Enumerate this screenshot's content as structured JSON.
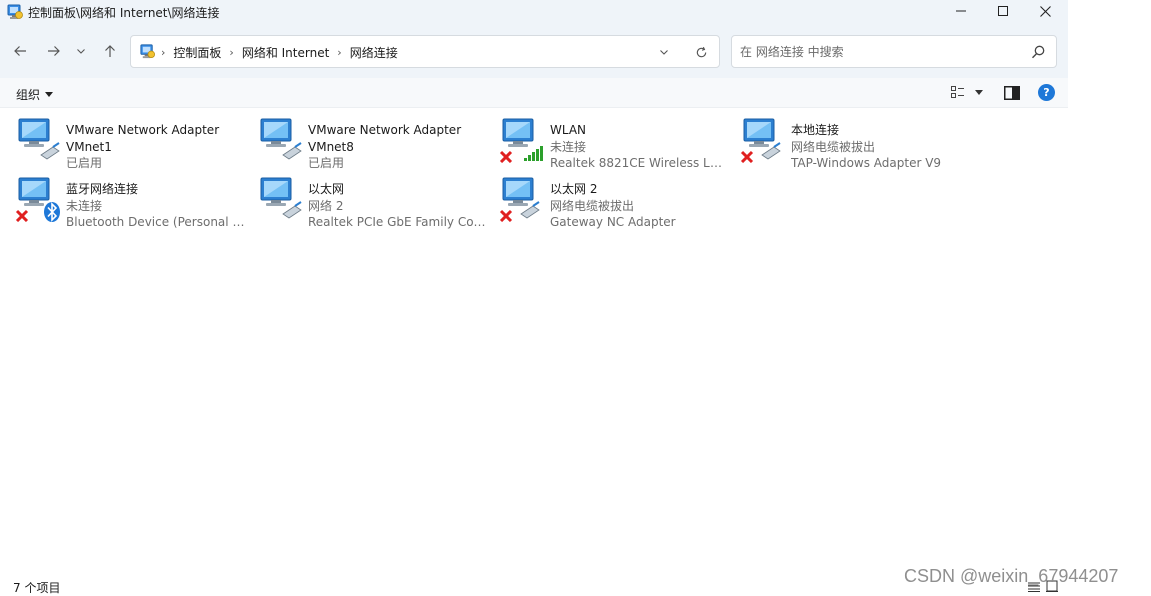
{
  "window": {
    "title": "控制面板\\网络和 Internet\\网络连接"
  },
  "navigation": {
    "breadcrumbs": [
      "控制面板",
      "网络和 Internet",
      "网络连接"
    ]
  },
  "search": {
    "placeholder": "在 网络连接 中搜索"
  },
  "toolbar": {
    "organize_label": "组织"
  },
  "connections": [
    {
      "name": "VMware Network Adapter",
      "status": "VMnet1",
      "device": "已启用",
      "status_icon": "none",
      "device_icon": "ethernet-cable-icon"
    },
    {
      "name": "VMware Network Adapter",
      "status": "VMnet8",
      "device": "已启用",
      "status_icon": "none",
      "device_icon": "ethernet-cable-icon"
    },
    {
      "name": "WLAN",
      "status": "未连接",
      "device": "Realtek 8821CE Wireless LAN ...",
      "status_icon": "red-x-icon",
      "device_icon": "wifi-signal-icon"
    },
    {
      "name": "本地连接",
      "status": "网络电缆被拔出",
      "device": "TAP-Windows Adapter V9",
      "status_icon": "red-x-icon",
      "device_icon": "ethernet-cable-icon"
    },
    {
      "name": "蓝牙网络连接",
      "status": "未连接",
      "device": "Bluetooth Device (Personal Ar...",
      "status_icon": "red-x-icon",
      "device_icon": "bluetooth-icon"
    },
    {
      "name": "以太网",
      "status": "网络 2",
      "device": "Realtek PCIe GbE Family Contr...",
      "status_icon": "none",
      "device_icon": "ethernet-cable-icon"
    },
    {
      "name": "以太网 2",
      "status": "网络电缆被拔出",
      "device": "Gateway NC Adapter",
      "status_icon": "red-x-icon",
      "device_icon": "ethernet-cable-icon"
    }
  ],
  "statusbar": {
    "item_count": "7 个项目"
  },
  "watermark": {
    "text": "CSDN @weixin_67944207"
  },
  "colors": {
    "chrome_background": "#eff4f9",
    "accent_blue": "#1e78d8",
    "error_red": "#e02020",
    "signal_green": "#2ca02c"
  }
}
